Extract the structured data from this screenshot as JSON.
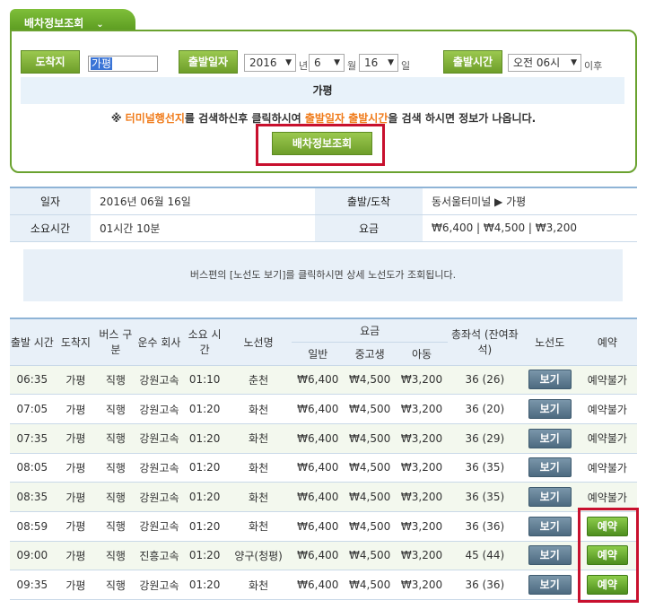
{
  "tab": {
    "label": "배차정보조회"
  },
  "form": {
    "dest_label": "도착지",
    "dest_value": "가평",
    "date_label": "출발일자",
    "year": "2016",
    "year_unit": "년",
    "month": "6",
    "month_unit": "월",
    "day": "16",
    "day_unit": "일",
    "time_label": "출발시간",
    "time": "오전 06시",
    "time_unit": "이후",
    "result_text": "가평",
    "notice_prefix": "※ ",
    "notice_term": "터미널행선지",
    "notice_mid": "를 검색하신후 클릭하시여 ",
    "notice_date": "출발일자 출발시간",
    "notice_suffix": "을 검색 하시면 정보가 나옵니다.",
    "search_button": "배차정보조회"
  },
  "info": {
    "date_label": "일자",
    "date_value": "2016년 06월 16일",
    "route_label": "출발/도착",
    "route_value": "동서울터미널 ▶ 가평",
    "duration_label": "소요시간",
    "duration_value": "01시간 10분",
    "fare_label": "요금",
    "fare_value": "₩6,400 | ₩4,500 | ₩3,200"
  },
  "route_notice": "버스편의 [노선도 보기]를 클릭하시면 상세 노선도가 조회됩니다.",
  "table": {
    "headers": {
      "time": "출발 시간",
      "dest": "도착지",
      "bus_type": "버스 구분",
      "company": "운수 회사",
      "duration": "소요 시간",
      "route": "노선명",
      "fare": "요금",
      "adult": "일반",
      "student": "중고생",
      "child": "아동",
      "seats": "총좌석 (잔여좌석)",
      "map": "노선도",
      "reserve": "예약"
    },
    "rows": [
      {
        "time": "06:35",
        "dest": "가평",
        "type": "직행",
        "company": "강원고속",
        "duration": "01:10",
        "route": "춘천",
        "adult": "₩6,400",
        "student": "₩4,500",
        "child": "₩3,200",
        "seats": "36 (26)",
        "map": "보기",
        "reserve": "예약불가"
      },
      {
        "time": "07:05",
        "dest": "가평",
        "type": "직행",
        "company": "강원고속",
        "duration": "01:20",
        "route": "화천",
        "adult": "₩6,400",
        "student": "₩4,500",
        "child": "₩3,200",
        "seats": "36 (20)",
        "map": "보기",
        "reserve": "예약불가"
      },
      {
        "time": "07:35",
        "dest": "가평",
        "type": "직행",
        "company": "강원고속",
        "duration": "01:20",
        "route": "화천",
        "adult": "₩6,400",
        "student": "₩4,500",
        "child": "₩3,200",
        "seats": "36 (29)",
        "map": "보기",
        "reserve": "예약불가"
      },
      {
        "time": "08:05",
        "dest": "가평",
        "type": "직행",
        "company": "강원고속",
        "duration": "01:20",
        "route": "화천",
        "adult": "₩6,400",
        "student": "₩4,500",
        "child": "₩3,200",
        "seats": "36 (35)",
        "map": "보기",
        "reserve": "예약불가"
      },
      {
        "time": "08:35",
        "dest": "가평",
        "type": "직행",
        "company": "강원고속",
        "duration": "01:20",
        "route": "화천",
        "adult": "₩6,400",
        "student": "₩4,500",
        "child": "₩3,200",
        "seats": "36 (35)",
        "map": "보기",
        "reserve": "예약불가"
      },
      {
        "time": "08:59",
        "dest": "가평",
        "type": "직행",
        "company": "강원고속",
        "duration": "01:20",
        "route": "화천",
        "adult": "₩6,400",
        "student": "₩4,500",
        "child": "₩3,200",
        "seats": "36 (36)",
        "map": "보기",
        "reserve": "예약"
      },
      {
        "time": "09:00",
        "dest": "가평",
        "type": "직행",
        "company": "진흥고속",
        "duration": "01:20",
        "route": "양구(청평)",
        "adult": "₩6,400",
        "student": "₩4,500",
        "child": "₩3,200",
        "seats": "45 (44)",
        "map": "보기",
        "reserve": "예약"
      },
      {
        "time": "09:35",
        "dest": "가평",
        "type": "직행",
        "company": "강원고속",
        "duration": "01:20",
        "route": "화천",
        "adult": "₩6,400",
        "student": "₩4,500",
        "child": "₩3,200",
        "seats": "36 (36)",
        "map": "보기",
        "reserve": "예약"
      }
    ]
  }
}
